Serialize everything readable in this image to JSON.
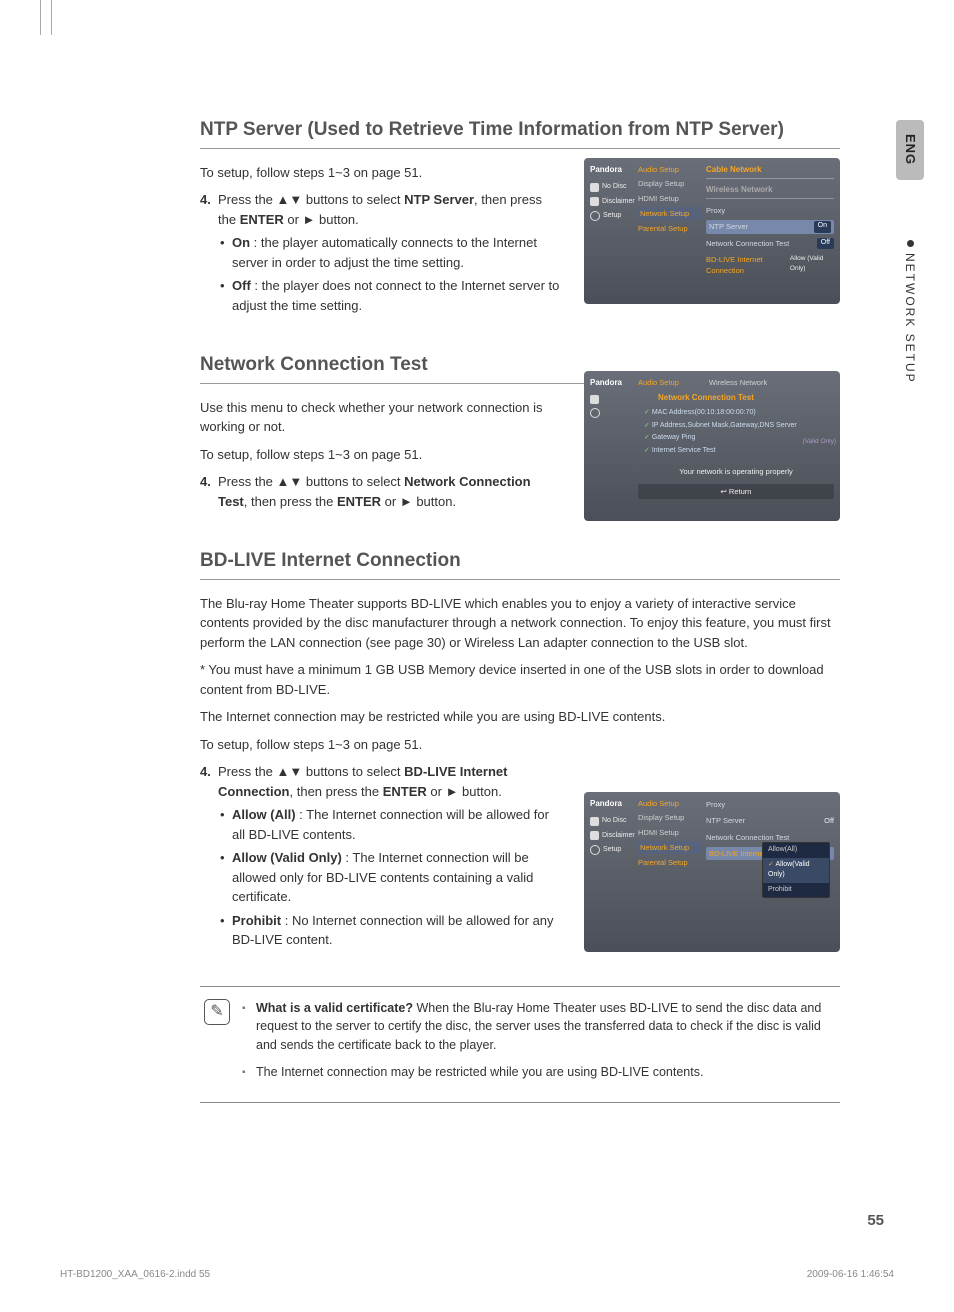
{
  "lang_tab": "ENG",
  "side_section": "NETWORK SETUP",
  "page_number": "55",
  "footer_file": "HT-BD1200_XAA_0616-2.indd   55",
  "footer_date": "2009-06-16   1:46:54",
  "s1": {
    "title": "NTP Server (Used to Retrieve Time Information from NTP Server)",
    "intro": "To setup, follow steps 1~3 on page 51.",
    "step_num": "4.",
    "step_a": "Press the ",
    "step_arrows": "▲▼",
    "step_b": " buttons to select ",
    "step_target": "NTP Server",
    "step_c": ", then press the ",
    "step_enter": "ENTER",
    "step_d": " or ► button.",
    "on_label": "On",
    "on_text": " : the player automatically connects to the Internet server in order to adjust the time setting.",
    "off_label": "Off",
    "off_text": " : the player does not connect to the Internet server to adjust the time setting."
  },
  "s2": {
    "title": "Network Connection Test",
    "intro1": "Use this menu to check whether your network connection is working or not.",
    "intro2": "To setup, follow steps 1~3 on page 51.",
    "step_num": "4.",
    "step_a": "Press the ",
    "step_arrows": "▲▼",
    "step_b": " buttons to select ",
    "step_target": "Network Connection Test",
    "step_c": ", then press the ",
    "step_enter": "ENTER",
    "step_d": " or ► button."
  },
  "s3": {
    "title": "BD-LIVE Internet Connection",
    "p1": "The Blu-ray Home Theater supports BD-LIVE which enables you to enjoy a variety of interactive service contents provided by the disc manufacturer through a network connection. To enjoy this feature, you must first perform the LAN connection (see page 30) or Wireless Lan adapter connection to the USB slot.",
    "p2": "* You must have a minimum 1 GB USB Memory device inserted in one of the USB slots in order to download content from BD-LIVE.",
    "p3": "The Internet connection may be restricted while you are using BD-LIVE contents.",
    "p4": "To setup, follow steps 1~3 on page 51.",
    "step_num": "4.",
    "step_a": "Press the ",
    "step_arrows": "▲▼",
    "step_b": " buttons to select ",
    "step_target": "BD-LIVE Internet Connection",
    "step_c": ", then press the ",
    "step_enter": "ENTER",
    "step_d": " or ► button.",
    "allow_all_label": "Allow (All)",
    "allow_all_text": " : The Internet connection will be allowed for all BD-LIVE contents.",
    "allow_valid_label": "Allow (Valid Only)",
    "allow_valid_text": " : The Internet connection will be allowed only for BD-LIVE contents containing a valid certificate.",
    "prohibit_label": "Prohibit",
    "prohibit_text": " : No Internet connection will be allowed for any BD-LIVE content."
  },
  "note": {
    "q_label": "What is a valid certificate?",
    "q_text": " When the Blu-ray Home Theater uses BD-LIVE to send the disc data and request to the server to certify the disc, the server uses the transferred data to check if the disc is valid and sends the certificate back to the player.",
    "n2": "The Internet connection may be restricted while you are using BD-LIVE contents."
  },
  "osd": {
    "logo": "Pandora",
    "no_disc": "No Disc",
    "disclaimer": "Disclaimer",
    "setup": "Setup",
    "audio_setup": "Audio Setup",
    "display_setup": "Display Setup",
    "hdmi_setup": "HDMI Setup",
    "network_setup": "Network Setup",
    "parental_setup": "Parental Setup",
    "cable_network": "Cable Network",
    "wireless_network": "Wireless Network",
    "proxy": "Proxy",
    "ntp_server": "NTP Server",
    "net_conn_test": "Network Connection Test",
    "bdlive_conn": "BD-LIVE Internet Connection",
    "on": "On",
    "off": "Off",
    "allow_valid": "Allow (Valid Only)",
    "allow_all": "Allow(All)",
    "allow_valid_short": "Allow(Valid Only)",
    "prohibit": "Prohibit",
    "mac": "MAC Address(00:10:18:00:00:70)",
    "ip": "IP Address,Subnet Mask,Gateway,DNS Server",
    "gateway": "Gateway Ping",
    "svc_test": "Internet Service Test",
    "net_ok": "Your network is operating properly",
    "return": "↩ Return",
    "valid_only_tag": "(Valid Only)"
  }
}
